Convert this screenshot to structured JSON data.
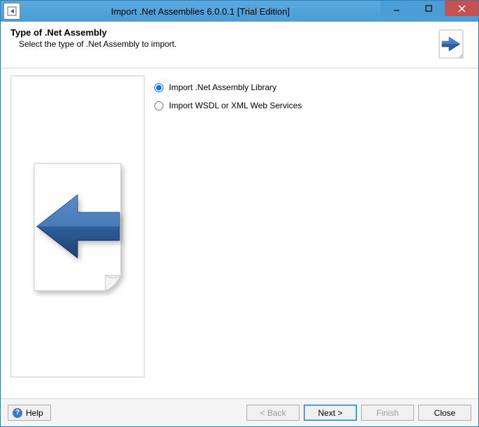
{
  "window": {
    "title": "Import .Net Assemblies 6.0.0.1 [Trial Edition]"
  },
  "header": {
    "heading": "Type of .Net Assembly",
    "subheading": "Select the type of .Net Assembly to import."
  },
  "options": {
    "library": "Import .Net Assembly Library",
    "wsdl": "Import WSDL or XML Web Services",
    "selected": "library"
  },
  "footer": {
    "help": "Help",
    "back": "< Back",
    "next": "Next >",
    "finish": "Finish",
    "close": "Close"
  }
}
